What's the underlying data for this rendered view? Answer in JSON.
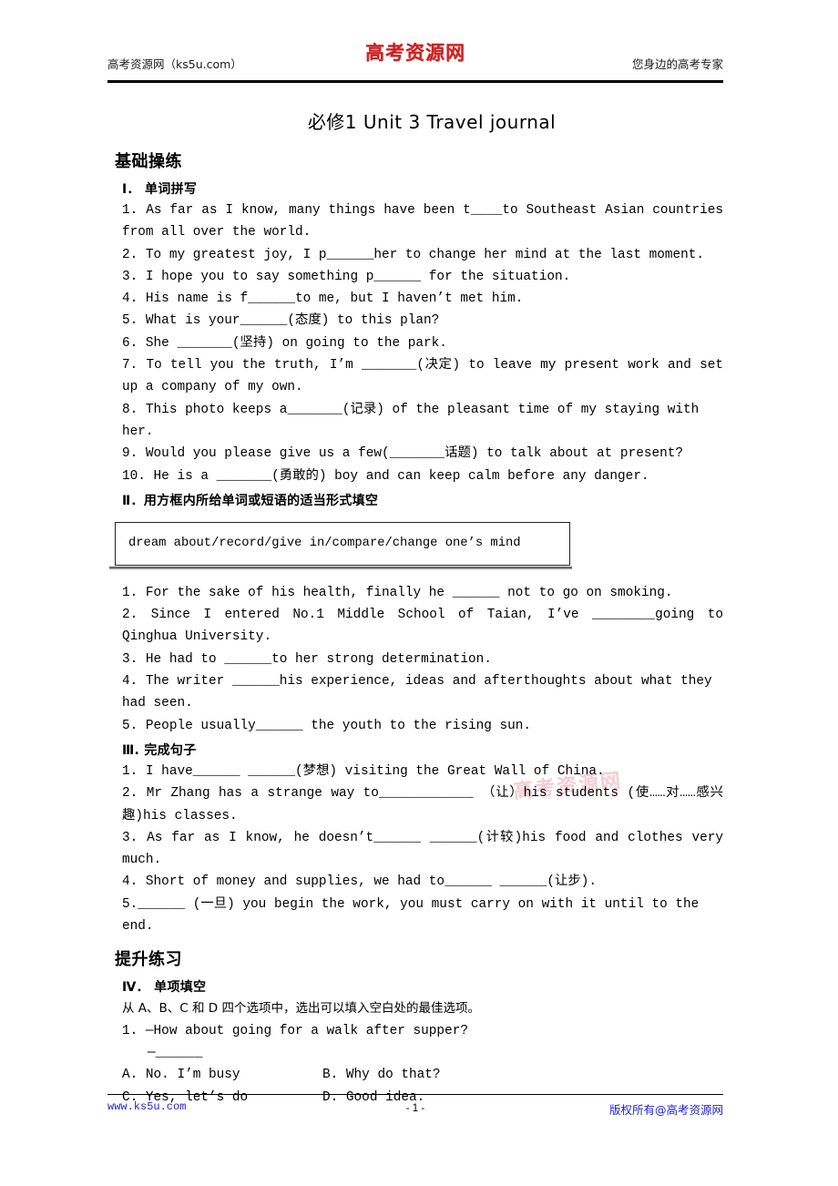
{
  "header": {
    "logo": "高考资源网",
    "left": "高考资源网（ks5u.com）",
    "right": "您身边的高考专家"
  },
  "footer": {
    "left": "www.ks5u.com",
    "center": "- 1 -",
    "right": "版权所有@高考资源网"
  },
  "watermark": "高考资源网",
  "doc": {
    "title": "必修1 Unit 3  Travel journal"
  },
  "sections": {
    "basic": "基础操练",
    "advanced": "提升练习"
  },
  "part1": {
    "heading": "Ⅰ．  单词拼写",
    "items": [
      "1. As far as I know, many things have been t____to Southeast Asian countries from all over the world.",
      "2. To my greatest joy, I p______her to change her mind at the last moment.",
      "3. I hope you to say something p______ for the situation.",
      "4. His name is f______to me, but I haven’t met him.",
      "5. What is your______(态度) to this plan?",
      "6. She _______(坚持) on going to the park.",
      "7. To tell you the truth, I’m _______(决定) to leave my present work and set up a company of my own.",
      "8. This photo keeps a_______(记录) of the pleasant time of my staying with her.",
      "9. Would you please give us a few(_______话题) to talk about at present?",
      "10. He is a _______(勇敢的) boy and can keep calm before any danger."
    ]
  },
  "part2": {
    "heading": "Ⅱ．用方框内所给单词或短语的适当形式填空",
    "word_bank": "dream about/record/give in/compare/change one’s mind",
    "items": [
      "1. For the sake of his health, finally he ______ not to go on smoking.",
      "2. Since I entered No.1 Middle School of Taian, I’ve ________going to Qinghua University.",
      "3. He had to  ______to her strong determination.",
      "4. The writer ______his experience, ideas and afterthoughts about what they had seen.",
      "5. People usually______  the youth to the rising sun."
    ]
  },
  "part3": {
    "heading": "Ⅲ. 完成句子",
    "items": [
      "1. I have______ ______(梦想) visiting the Great Wall of China.",
      "2. Mr Zhang has a strange way to____________ （让）his students (使……对……感兴趣)his classes.",
      "3. As far as I know, he doesn’t______  ______(计较)his food and clothes very much.",
      "4. Short of money and supplies, we had to______ ______(让步).",
      "5.______  (一旦) you begin the work, you must carry on with it until to the end."
    ]
  },
  "part4": {
    "heading": "Ⅳ．  单项填空",
    "instruction": "从 A、B、C 和 D 四个选项中，选出可以填入空白处的最佳选项。",
    "question_stem": "1. —How about going for a walk after supper?",
    "question_answer_line": "—______",
    "options": [
      "A. No. I’m busy",
      "B. Why do that?",
      "C. Yes, let’s do",
      "D. Good idea."
    ]
  }
}
